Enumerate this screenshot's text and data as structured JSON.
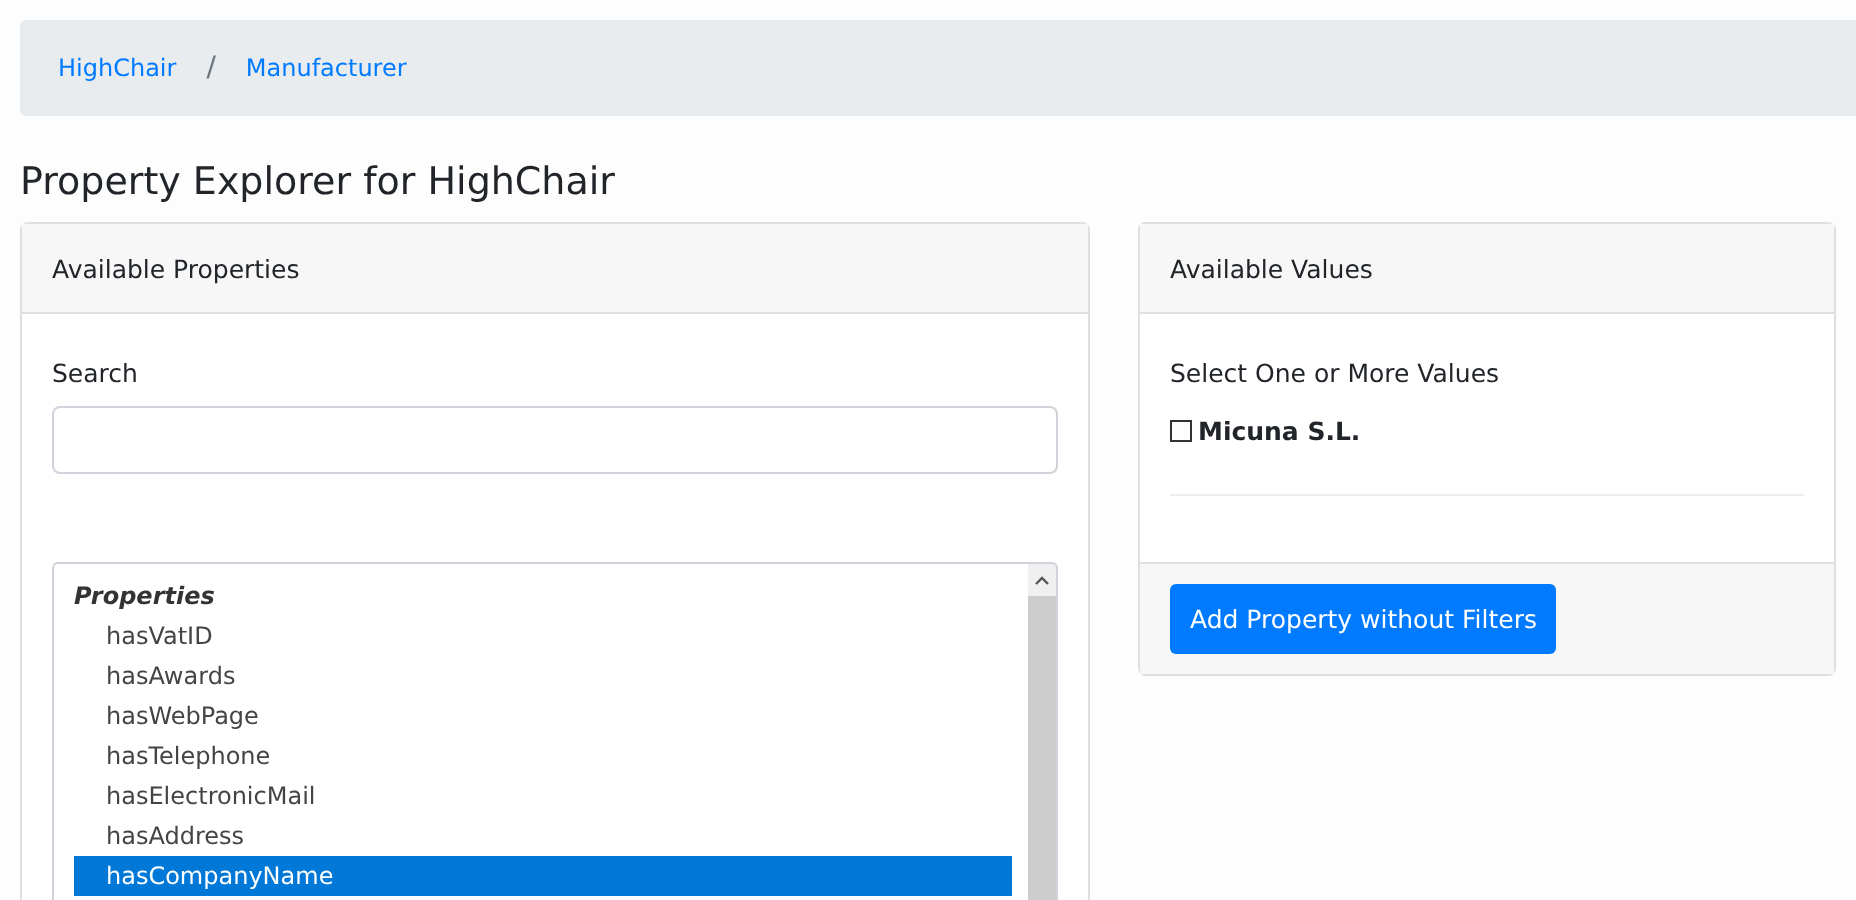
{
  "breadcrumb": {
    "items": [
      "HighChair",
      "Manufacturer"
    ],
    "separator": "/"
  },
  "title": "Property Explorer for HighChair",
  "properties_card": {
    "header": "Available Properties",
    "search_label": "Search",
    "list": {
      "group": "Properties",
      "items": [
        {
          "label": "hasVatID",
          "selected": false
        },
        {
          "label": "hasAwards",
          "selected": false
        },
        {
          "label": "hasWebPage",
          "selected": false
        },
        {
          "label": "hasTelephone",
          "selected": false
        },
        {
          "label": "hasElectronicMail",
          "selected": false
        },
        {
          "label": "hasAddress",
          "selected": false
        },
        {
          "label": "hasCompanyName",
          "selected": true
        }
      ]
    }
  },
  "values_card": {
    "header": "Available Values",
    "prompt": "Select One or More Values",
    "values": [
      {
        "label": "Micuna S.L.",
        "checked": false
      }
    ],
    "button": "Add Property without Filters"
  }
}
